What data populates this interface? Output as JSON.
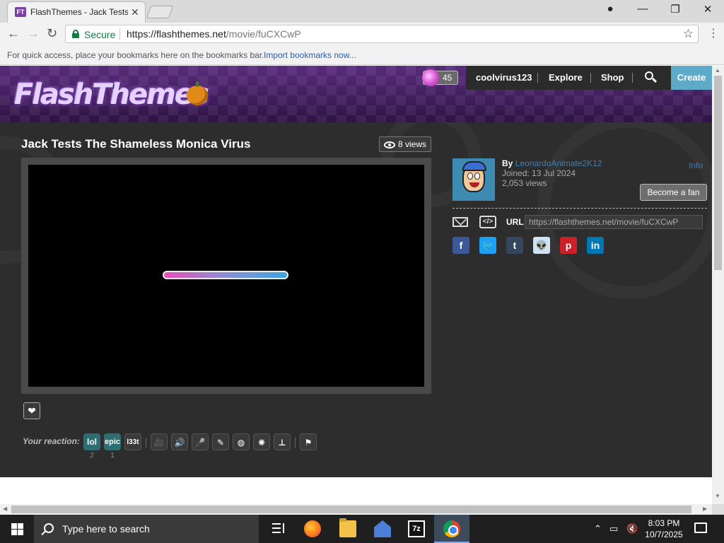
{
  "browser": {
    "tab_title": "FlashThemes - Jack Tests",
    "favicon_text": "FT",
    "secure_label": "Secure",
    "url_host": "https://flashthemes.net",
    "url_path": "/movie/fuCXCwP",
    "bookmarks_hint": "For quick access, place your bookmarks here on the bookmarks bar.",
    "import_bookmarks": "Import bookmarks now..."
  },
  "site": {
    "logo_text": "FlashThemes",
    "coins": "45",
    "nav": {
      "username": "coolvirus123",
      "explore": "Explore",
      "shop": "Shop",
      "create": "Create"
    }
  },
  "movie": {
    "title": "Jack Tests The Shameless Monica Virus",
    "views": "8 views",
    "loading_progress": 1.0
  },
  "author": {
    "by_label": "By",
    "name": "LeonardoAnimate2K12",
    "joined": "Joined: 13 Jul 2024",
    "views": "2,053 views",
    "info_link": "Info",
    "fan_button": "Become a fan",
    "url_label": "URL",
    "share_url": "https://flashthemes.net/movie/fuCXCwP"
  },
  "reactions": {
    "label": "Your reaction:",
    "items": [
      {
        "label": "lol",
        "count": "2"
      },
      {
        "label": "epic",
        "count": "1"
      },
      {
        "label": "l33t",
        "count": ""
      }
    ]
  },
  "share_icons": [
    "f",
    "t",
    "t",
    "r",
    "p",
    "in"
  ],
  "taskbar": {
    "search_placeholder": "Type here to search",
    "time": "8:03 PM",
    "date": "10/7/2025",
    "sevenzip_label": "7z"
  }
}
